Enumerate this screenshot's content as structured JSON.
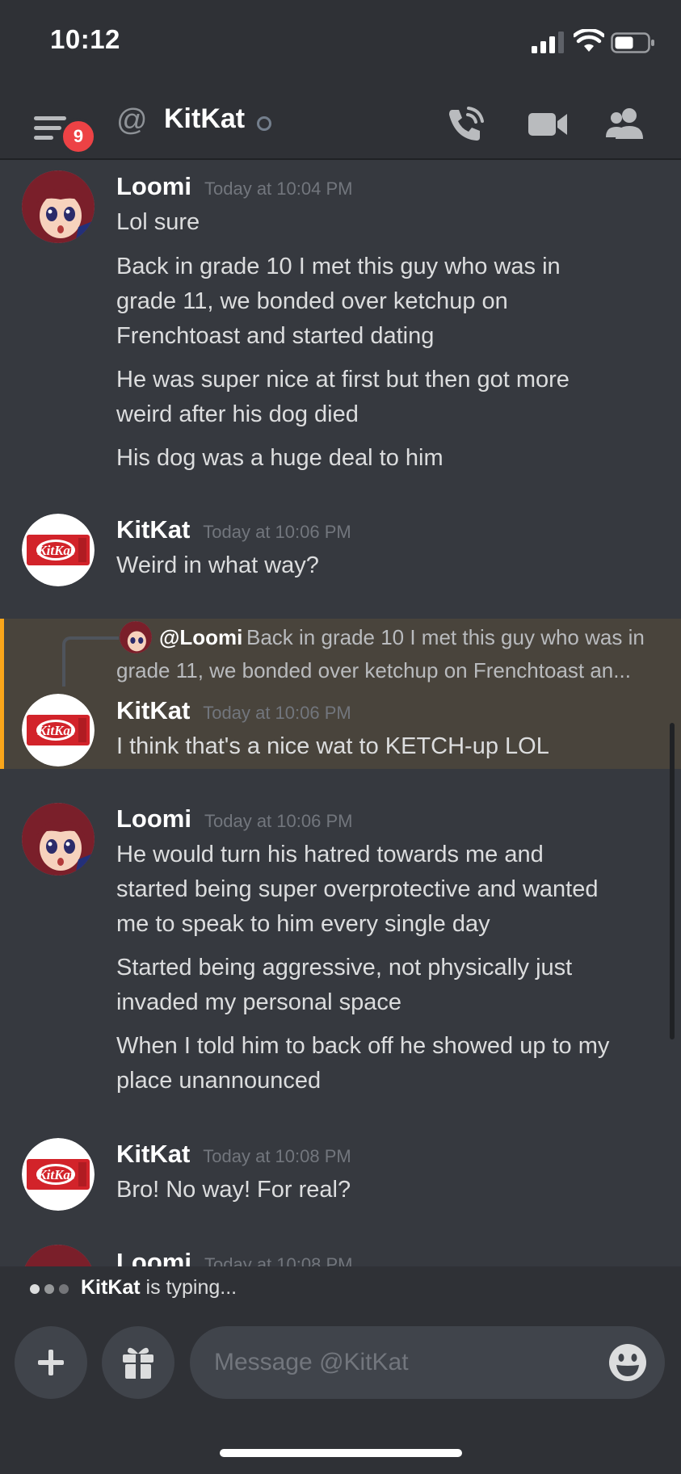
{
  "status_bar": {
    "time": "10:12"
  },
  "header": {
    "badge_count": "9",
    "at_symbol": "@",
    "channel_name": "KitKat"
  },
  "messages": [
    {
      "author": "Loomi",
      "timestamp": "Today at 10:04 PM",
      "lines": [
        "Lol sure",
        "Back in grade 10 I met this guy who was in",
        "grade 11, we bonded over ketchup on",
        "Frenchtoast and started dating",
        "He was super nice at first but then got more",
        "weird after his dog died",
        "His dog was a huge deal to him"
      ]
    },
    {
      "author": "KitKat",
      "timestamp": "Today at 10:06 PM",
      "lines": [
        "Weird in what way?"
      ]
    },
    {
      "author": "KitKat",
      "timestamp": "Today at 10:06 PM",
      "lines": [
        "I think that's a nice wat to KETCH-up LOL"
      ],
      "reply": {
        "name": "@Loomi",
        "text_1": "Back in grade 10 I met this guy who was in",
        "text_2": "grade 11, we bonded over ketchup on Frenchtoast an..."
      }
    },
    {
      "author": "Loomi",
      "timestamp": "Today at 10:06 PM",
      "lines": [
        "He would turn his hatred towards me and",
        "started being super overprotective and wanted",
        "me to speak to him every single day",
        "Started being aggressive, not physically just",
        "invaded my personal space",
        "When I told him to back off he showed up to my",
        "place unannounced"
      ]
    },
    {
      "author": "KitKat",
      "timestamp": "Today at 10:08 PM",
      "lines": [
        "Bro! No way! For real?"
      ]
    },
    {
      "author": "Loomi",
      "timestamp": "Today at 10:08 PM",
      "lines": []
    }
  ],
  "typing": {
    "name": "KitKat",
    "suffix": " is typing..."
  },
  "composer": {
    "placeholder": "Message @KitKat"
  },
  "colors": {
    "accent": "#faa61a",
    "badge": "#ed4245",
    "background": "#36393f",
    "header": "#2f3136"
  },
  "icons": [
    "menu-icon",
    "phone-call-icon",
    "video-camera-icon",
    "members-icon",
    "plus-icon",
    "gift-icon",
    "emoji-icon"
  ]
}
